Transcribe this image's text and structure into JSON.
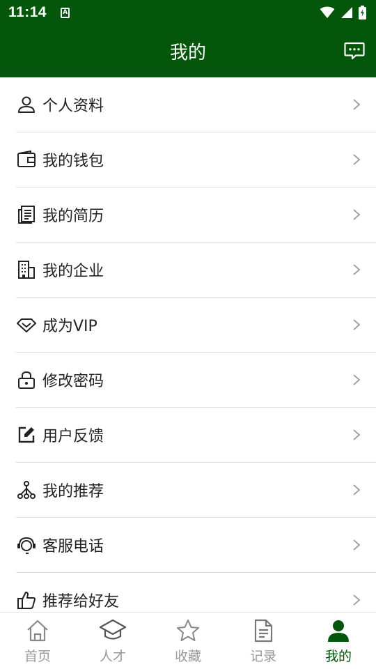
{
  "status_bar": {
    "time": "11:14",
    "notification_letter": "A"
  },
  "header": {
    "title": "我的"
  },
  "menu": {
    "items": [
      {
        "label": "个人资料",
        "icon": "person-icon"
      },
      {
        "label": "我的钱包",
        "icon": "wallet-icon"
      },
      {
        "label": "我的简历",
        "icon": "resume-icon"
      },
      {
        "label": "我的企业",
        "icon": "building-icon"
      },
      {
        "label": "成为VIP",
        "icon": "diamond-icon"
      },
      {
        "label": "修改密码",
        "icon": "lock-icon"
      },
      {
        "label": "用户反馈",
        "icon": "edit-icon"
      },
      {
        "label": "我的推荐",
        "icon": "share-tree-icon"
      },
      {
        "label": "客服电话",
        "icon": "headset-icon"
      },
      {
        "label": "推荐给好友",
        "icon": "thumbs-up-icon"
      }
    ]
  },
  "tabbar": {
    "active": "我的",
    "tabs": [
      {
        "label": "首页",
        "icon": "home-icon"
      },
      {
        "label": "人才",
        "icon": "graduation-cap-icon"
      },
      {
        "label": "收藏",
        "icon": "star-icon"
      },
      {
        "label": "记录",
        "icon": "document-icon"
      },
      {
        "label": "我的",
        "icon": "user-filled-icon"
      }
    ]
  },
  "colors": {
    "brand": "#03560a",
    "inactive": "#999999",
    "divider": "#dcdcdc"
  }
}
